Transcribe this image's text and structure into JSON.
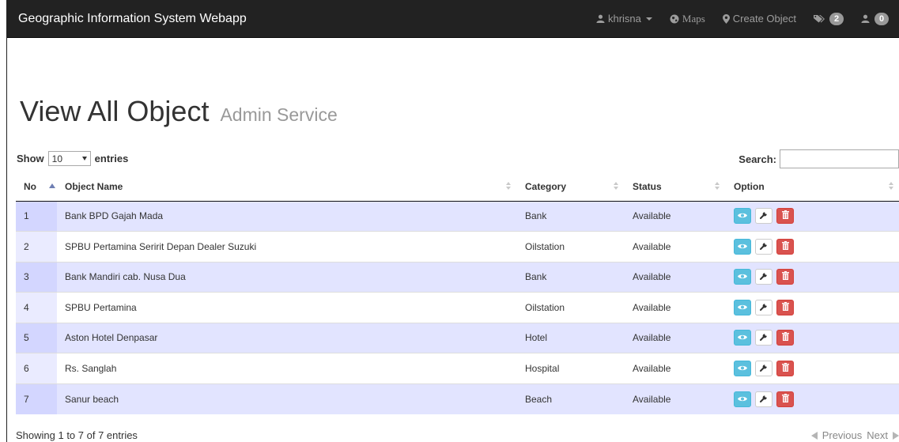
{
  "navbar": {
    "brand": "Geographic Information System Webapp",
    "user": "khrisna",
    "maps": "Maps",
    "create_object": "Create Object",
    "tag_count": "2",
    "user_count": "0"
  },
  "page": {
    "title": "View All Object",
    "subtitle": "Admin Service"
  },
  "controls": {
    "show_label": "Show",
    "entries_value": "10",
    "entries_label": "entries",
    "search_label": "Search:",
    "search_value": ""
  },
  "table": {
    "headers": [
      "No",
      "Object Name",
      "Category",
      "Status",
      "Option"
    ],
    "rows": [
      {
        "no": "1",
        "name": "Bank BPD Gajah Mada",
        "category": "Bank",
        "status": "Available"
      },
      {
        "no": "2",
        "name": "SPBU Pertamina Seririt Depan Dealer Suzuki",
        "category": "Oilstation",
        "status": "Available"
      },
      {
        "no": "3",
        "name": "Bank Mandiri cab. Nusa Dua",
        "category": "Bank",
        "status": "Available"
      },
      {
        "no": "4",
        "name": "SPBU Pertamina",
        "category": "Oilstation",
        "status": "Available"
      },
      {
        "no": "5",
        "name": "Aston Hotel Denpasar",
        "category": "Hotel",
        "status": "Available"
      },
      {
        "no": "6",
        "name": "Rs. Sanglah",
        "category": "Hospital",
        "status": "Available"
      },
      {
        "no": "7",
        "name": "Sanur beach",
        "category": "Beach",
        "status": "Available"
      }
    ]
  },
  "footer": {
    "info": "Showing 1 to 7 of 7 entries",
    "previous": "Previous",
    "next": "Next"
  },
  "colors": {
    "navbar": "#222222",
    "odd_row": "#e2e4ff",
    "view_button": "#5bc0de",
    "delete_button": "#d9534f"
  },
  "icons": {
    "user": "user-icon",
    "maps": "globe-icon",
    "create": "map-marker-icon",
    "tags": "tags-icon",
    "users": "user-icon",
    "view": "eye-icon",
    "edit": "wrench-icon",
    "delete": "trash-icon"
  }
}
